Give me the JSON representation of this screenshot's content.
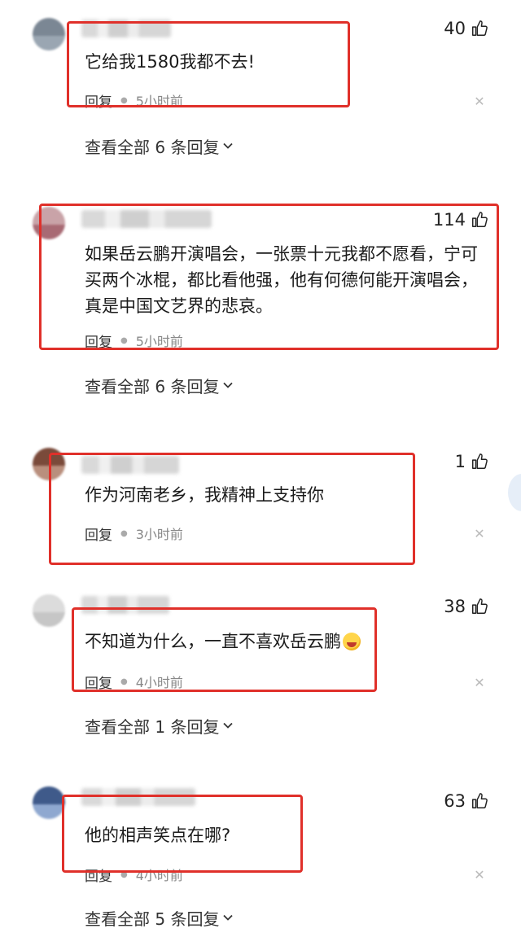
{
  "comments": [
    {
      "likes": "40",
      "text": "它给我1580我都不去!",
      "reply_label": "回复",
      "time": "5小时前",
      "view_all": "查看全部 6 条回复",
      "avatar_colors": [
        "#7b8794",
        "#9aa6b2"
      ]
    },
    {
      "likes": "114",
      "text": "如果岳云鹏开演唱会，一张票十元我都不愿看，宁可买两个冰棍，都比看他强，他有何德何能开演唱会，真是中国文艺界的悲哀。",
      "reply_label": "回复",
      "time": "5小时前",
      "view_all": "查看全部 6 条回复",
      "avatar_colors": [
        "#c9a3a8",
        "#a86a74"
      ]
    },
    {
      "likes": "1",
      "text": "作为河南老乡，我精神上支持你",
      "reply_label": "回复",
      "time": "3小时前",
      "avatar_colors": [
        "#7a4a3a",
        "#b98f7d"
      ]
    },
    {
      "likes": "38",
      "text": "不知道为什么，一直不喜欢岳云鹏",
      "reply_label": "回复",
      "time": "4小时前",
      "view_all": "查看全部 1 条回复",
      "avatar_colors": [
        "#dcdcdc",
        "#c6c6c6"
      ]
    },
    {
      "likes": "63",
      "text": "他的相声笑点在哪?",
      "reply_label": "回复",
      "time": "4小时前",
      "view_all": "查看全部 5 条回复",
      "avatar_colors": [
        "#3f5a8a",
        "#8fa8d0"
      ]
    }
  ],
  "colors": {
    "highlight": "#e0302a",
    "text": "#1a1a1a",
    "meta": "#888888"
  }
}
